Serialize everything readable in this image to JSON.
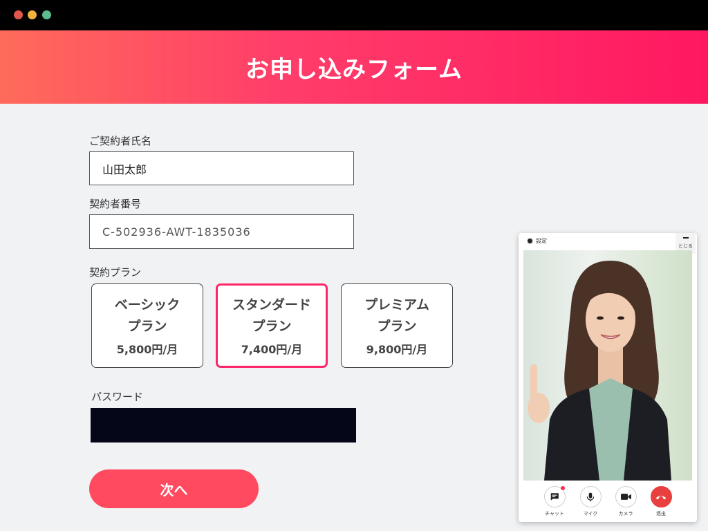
{
  "header": {
    "title": "お申し込みフォーム"
  },
  "form": {
    "name_label": "ご契約者氏名",
    "name_value": "山田太郎",
    "number_label": "契約者番号",
    "number_value": "C-502936-AWT-1835036",
    "plan_label": "契約プラン",
    "plans": [
      {
        "name1": "ベーシック",
        "name2": "プラン",
        "price": "5,800円/月",
        "selected": false
      },
      {
        "name1": "スタンダード",
        "name2": "プラン",
        "price": "7,400円/月",
        "selected": true
      },
      {
        "name1": "プレミアム",
        "name2": "プラン",
        "price": "9,800円/月",
        "selected": false
      }
    ],
    "password_label": "パスワード",
    "next_label": "次へ"
  },
  "video_panel": {
    "settings_label": "設定",
    "close_label": "とじる",
    "controls": [
      {
        "icon": "chat-icon",
        "label": "チャット"
      },
      {
        "icon": "mic-icon",
        "label": "マイク"
      },
      {
        "icon": "camera-icon",
        "label": "カメラ"
      },
      {
        "icon": "hangup-icon",
        "label": "退出"
      }
    ]
  },
  "colors": {
    "accent": "#ff2468",
    "next_button": "#ff4a5f",
    "hangup": "#e8403e"
  }
}
